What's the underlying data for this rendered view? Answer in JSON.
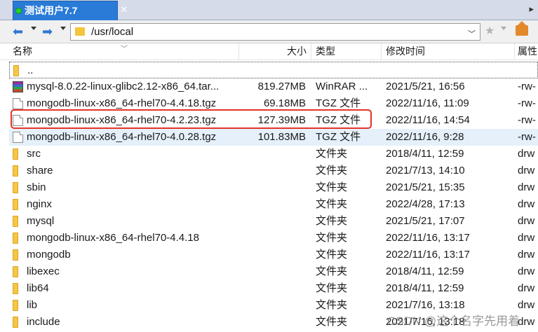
{
  "tab": {
    "title": "测试用户7.7",
    "close": "✕",
    "arrow": "▸"
  },
  "toolbar": {
    "path": "/usr/local",
    "back_icon": "back-arrow-icon",
    "forward_icon": "forward-arrow-icon"
  },
  "columns": {
    "name": "名称",
    "size": "大小",
    "type": "类型",
    "mtime": "修改时间",
    "attr": "属性"
  },
  "updir": "..",
  "files": [
    {
      "icon": "rar",
      "name": "mysql-8.0.22-linux-glibc2.12-x86_64.tar...",
      "size": "819.27MB",
      "type": "WinRAR ...",
      "mtime": "2021/5/21, 16:56",
      "attr": "-rw-"
    },
    {
      "icon": "file",
      "name": "mongodb-linux-x86_64-rhel70-4.4.18.tgz",
      "size": "69.18MB",
      "type": "TGZ 文件",
      "mtime": "2022/11/16, 11:09",
      "attr": "-rw-"
    },
    {
      "icon": "file",
      "name": "mongodb-linux-x86_64-rhel70-4.2.23.tgz",
      "size": "127.39MB",
      "type": "TGZ 文件",
      "mtime": "2022/11/16, 14:54",
      "attr": "-rw-"
    },
    {
      "icon": "file",
      "name": "mongodb-linux-x86_64-rhel70-4.0.28.tgz",
      "size": "101.83MB",
      "type": "TGZ 文件",
      "mtime": "2022/11/16, 9:28",
      "attr": "-rw-",
      "selected": true
    },
    {
      "icon": "folder",
      "name": "src",
      "size": "",
      "type": "文件夹",
      "mtime": "2018/4/11, 12:59",
      "attr": "drw"
    },
    {
      "icon": "folder",
      "name": "share",
      "size": "",
      "type": "文件夹",
      "mtime": "2021/7/13, 14:10",
      "attr": "drw"
    },
    {
      "icon": "folder",
      "name": "sbin",
      "size": "",
      "type": "文件夹",
      "mtime": "2021/5/21, 15:35",
      "attr": "drw"
    },
    {
      "icon": "folder",
      "name": "nginx",
      "size": "",
      "type": "文件夹",
      "mtime": "2022/4/28, 17:13",
      "attr": "drw"
    },
    {
      "icon": "folder",
      "name": "mysql",
      "size": "",
      "type": "文件夹",
      "mtime": "2021/5/21, 17:07",
      "attr": "drw"
    },
    {
      "icon": "folder",
      "name": "mongodb-linux-x86_64-rhel70-4.4.18",
      "size": "",
      "type": "文件夹",
      "mtime": "2022/11/16, 13:17",
      "attr": "drw"
    },
    {
      "icon": "folder",
      "name": "mongodb",
      "size": "",
      "type": "文件夹",
      "mtime": "2022/11/16, 13:17",
      "attr": "drw"
    },
    {
      "icon": "folder",
      "name": "libexec",
      "size": "",
      "type": "文件夹",
      "mtime": "2018/4/11, 12:59",
      "attr": "drw"
    },
    {
      "icon": "folder",
      "name": "lib64",
      "size": "",
      "type": "文件夹",
      "mtime": "2018/4/11, 12:59",
      "attr": "drw"
    },
    {
      "icon": "folder",
      "name": "lib",
      "size": "",
      "type": "文件夹",
      "mtime": "2021/7/16, 13:18",
      "attr": "drw"
    },
    {
      "icon": "folder",
      "name": "include",
      "size": "",
      "type": "文件夹",
      "mtime": "2021/7/16, 13:18",
      "attr": "drw"
    }
  ],
  "watermark": "CSDN @这个名字先用着",
  "colors": {
    "tab_bg": "#2a7bd8",
    "highlight": "#e53327",
    "selected_row": "#e5f0fb"
  }
}
